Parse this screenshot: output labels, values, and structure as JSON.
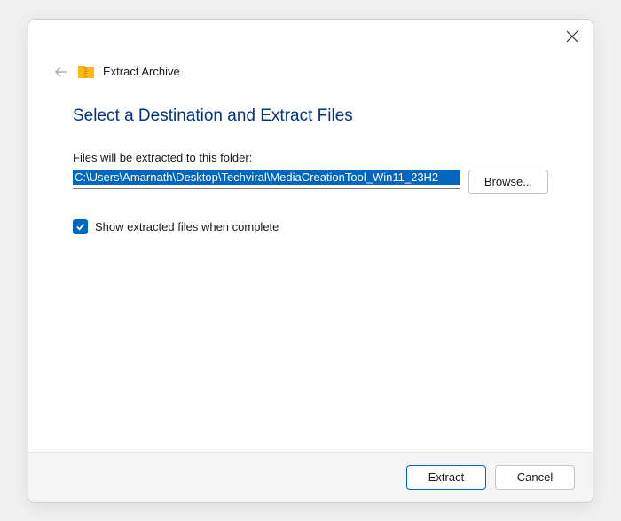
{
  "titlebar": {
    "title": "Extract Archive"
  },
  "content": {
    "heading": "Select a Destination and Extract Files",
    "path_label": "Files will be extracted to this folder:",
    "path_value": "C:\\Users\\Amarnath\\Desktop\\Techviral\\MediaCreationTool_Win11_23H2",
    "browse_label": "Browse...",
    "checkbox_label": "Show extracted files when complete",
    "checkbox_checked": true
  },
  "footer": {
    "extract_label": "Extract",
    "cancel_label": "Cancel"
  }
}
